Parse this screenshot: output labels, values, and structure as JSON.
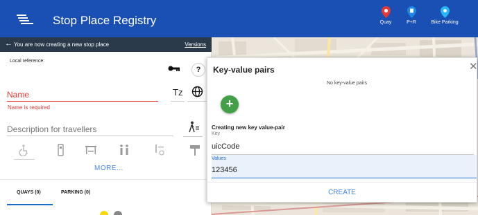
{
  "header": {
    "title": "Stop Place Registry",
    "legend": [
      {
        "label": "Quay",
        "icon": "quay-marker-icon",
        "color": "#e53935"
      },
      {
        "label": "P+R",
        "icon": "park-ride-marker-icon",
        "color": "#1e88e5"
      },
      {
        "label": "Bike Parking",
        "icon": "bike-parking-marker-icon",
        "color": "#29b6f6"
      }
    ]
  },
  "editor": {
    "creating_banner": "You are now creating a new stop place",
    "versions_link": "Versions",
    "local_reference_label": "Local reference:",
    "name_placeholder": "Name",
    "name_error": "Name is required",
    "tz_label": "Tz",
    "description_placeholder": "Description for travellers",
    "more_label": "MORE...",
    "tabs": [
      {
        "label": "QUAYS (0)",
        "active": true
      },
      {
        "label": "PARKING (0)",
        "active": false
      }
    ]
  },
  "key_value_dialog": {
    "title": "Key-value pairs",
    "empty_text": "No key-value pairs",
    "add_icon": "+",
    "new_pair_title": "Creating new key value-pair",
    "key_label": "Key",
    "key_value": "uicCode",
    "values_label": "Values",
    "values_value": "123456",
    "create_label": "CREATE"
  },
  "colors": {
    "header_bg": "#1a4fb3",
    "banner_bg": "#2b3a4a",
    "error": "#e53935",
    "accent": "#4a86e8",
    "add_button": "#43a047"
  }
}
